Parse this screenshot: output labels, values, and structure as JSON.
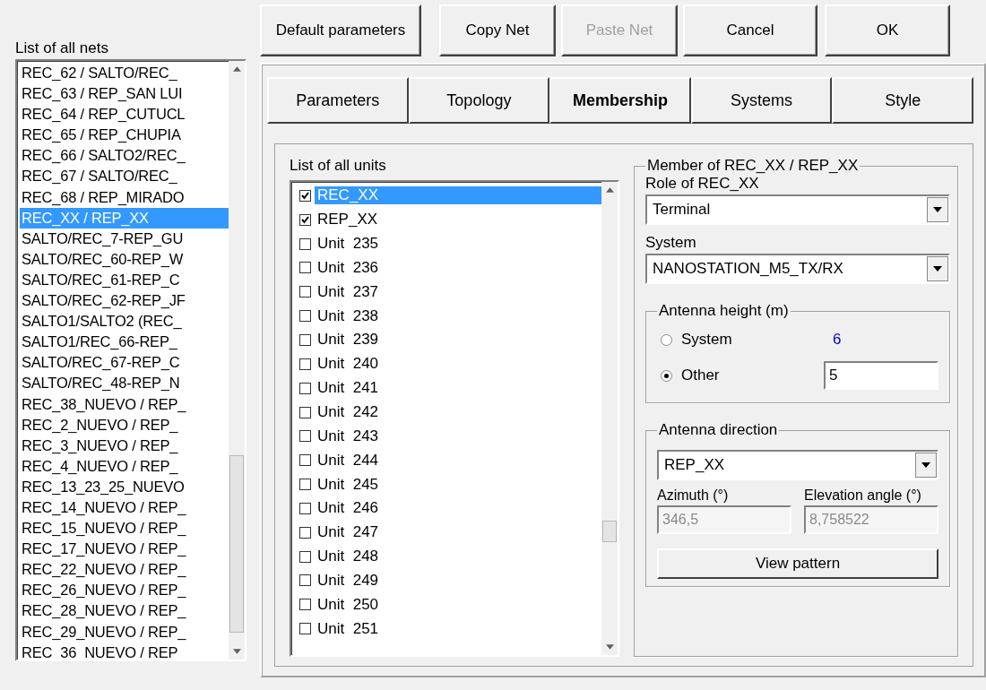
{
  "top_buttons": [
    {
      "label": "Default parameters",
      "disabled": false
    },
    {
      "label": "Copy Net",
      "disabled": false
    },
    {
      "label": "Paste Net",
      "disabled": true
    },
    {
      "label": "Cancel",
      "disabled": false
    },
    {
      "label": "OK",
      "disabled": false
    }
  ],
  "nets_list": {
    "label": "List of all nets",
    "items": [
      {
        "text": "REC_62 / SALTO/REC_",
        "selected": false
      },
      {
        "text": "REC_63 / REP_SAN LUI",
        "selected": false
      },
      {
        "text": "REC_64 / REP_CUTUCL",
        "selected": false
      },
      {
        "text": "REC_65 / REP_CHUPIA",
        "selected": false
      },
      {
        "text": "REC_66 / SALTO2/REC_",
        "selected": false
      },
      {
        "text": "REC_67 / SALTO/REC_",
        "selected": false
      },
      {
        "text": "REC_68 / REP_MIRADO",
        "selected": false
      },
      {
        "text": "REC_XX / REP_XX",
        "selected": true
      },
      {
        "text": "SALTO/REC_7-REP_GU",
        "selected": false
      },
      {
        "text": "SALTO/REC_60-REP_W",
        "selected": false
      },
      {
        "text": "SALTO/REC_61-REP_C",
        "selected": false
      },
      {
        "text": "SALTO/REC_62-REP_JF",
        "selected": false
      },
      {
        "text": "SALTO1/SALTO2 (REC_",
        "selected": false
      },
      {
        "text": "SALTO1/REC_66-REP_",
        "selected": false
      },
      {
        "text": "SALTO/REC_67-REP_C",
        "selected": false
      },
      {
        "text": "SALTO/REC_48-REP_N",
        "selected": false
      },
      {
        "text": "REC_38_NUEVO / REP_",
        "selected": false
      },
      {
        "text": "REC_2_NUEVO / REP_",
        "selected": false
      },
      {
        "text": "REC_3_NUEVO / REP_",
        "selected": false
      },
      {
        "text": "REC_4_NUEVO / REP_",
        "selected": false
      },
      {
        "text": "REC_13_23_25_NUEVO",
        "selected": false
      },
      {
        "text": "REC_14_NUEVO / REP_",
        "selected": false
      },
      {
        "text": "REC_15_NUEVO / REP_",
        "selected": false
      },
      {
        "text": "REC_17_NUEVO / REP_",
        "selected": false
      },
      {
        "text": "REC_22_NUEVO / REP_",
        "selected": false
      },
      {
        "text": "REC_26_NUEVO / REP_",
        "selected": false
      },
      {
        "text": "REC_28_NUEVO / REP_",
        "selected": false
      },
      {
        "text": "REC_29_NUEVO / REP_",
        "selected": false
      },
      {
        "text": "REC_36_NUEVO / REP_",
        "selected": false
      }
    ]
  },
  "tabs": [
    {
      "label": "Parameters",
      "selected": false
    },
    {
      "label": "Topology",
      "selected": false
    },
    {
      "label": "Membership",
      "selected": true
    },
    {
      "label": "Systems",
      "selected": false
    },
    {
      "label": "Style",
      "selected": false
    }
  ],
  "units_list": {
    "label": "List of all units",
    "items": [
      {
        "text": "REC_XX",
        "checked": true,
        "selected": true
      },
      {
        "text": "REP_XX",
        "checked": true,
        "selected": false
      },
      {
        "text": "Unit  235",
        "checked": false,
        "selected": false
      },
      {
        "text": "Unit  236",
        "checked": false,
        "selected": false
      },
      {
        "text": "Unit  237",
        "checked": false,
        "selected": false
      },
      {
        "text": "Unit  238",
        "checked": false,
        "selected": false
      },
      {
        "text": "Unit  239",
        "checked": false,
        "selected": false
      },
      {
        "text": "Unit  240",
        "checked": false,
        "selected": false
      },
      {
        "text": "Unit  241",
        "checked": false,
        "selected": false
      },
      {
        "text": "Unit  242",
        "checked": false,
        "selected": false
      },
      {
        "text": "Unit  243",
        "checked": false,
        "selected": false
      },
      {
        "text": "Unit  244",
        "checked": false,
        "selected": false
      },
      {
        "text": "Unit  245",
        "checked": false,
        "selected": false
      },
      {
        "text": "Unit  246",
        "checked": false,
        "selected": false
      },
      {
        "text": "Unit  247",
        "checked": false,
        "selected": false
      },
      {
        "text": "Unit  248",
        "checked": false,
        "selected": false
      },
      {
        "text": "Unit  249",
        "checked": false,
        "selected": false
      },
      {
        "text": "Unit  250",
        "checked": false,
        "selected": false
      },
      {
        "text": "Unit  251",
        "checked": false,
        "selected": false
      }
    ]
  },
  "member_group": {
    "title": "Member of REC_XX / REP_XX",
    "role_label": "Role of REC_XX",
    "role_value": "Terminal",
    "system_label": "System",
    "system_value": "NANOSTATION_M5_TX/RX",
    "height_group": {
      "title": "Antenna height (m)",
      "options": [
        {
          "label": "System",
          "selected": false
        },
        {
          "label": "Other",
          "selected": true
        }
      ],
      "system_value": "6",
      "other_value": "5"
    },
    "direction_group": {
      "title": "Antenna direction",
      "target": "REP_XX",
      "azimuth_label": "Azimuth (°)",
      "azimuth_value": "346,5",
      "elevation_label": "Elevation angle (°)",
      "elevation_value": "8,758522",
      "button": "View pattern"
    }
  }
}
